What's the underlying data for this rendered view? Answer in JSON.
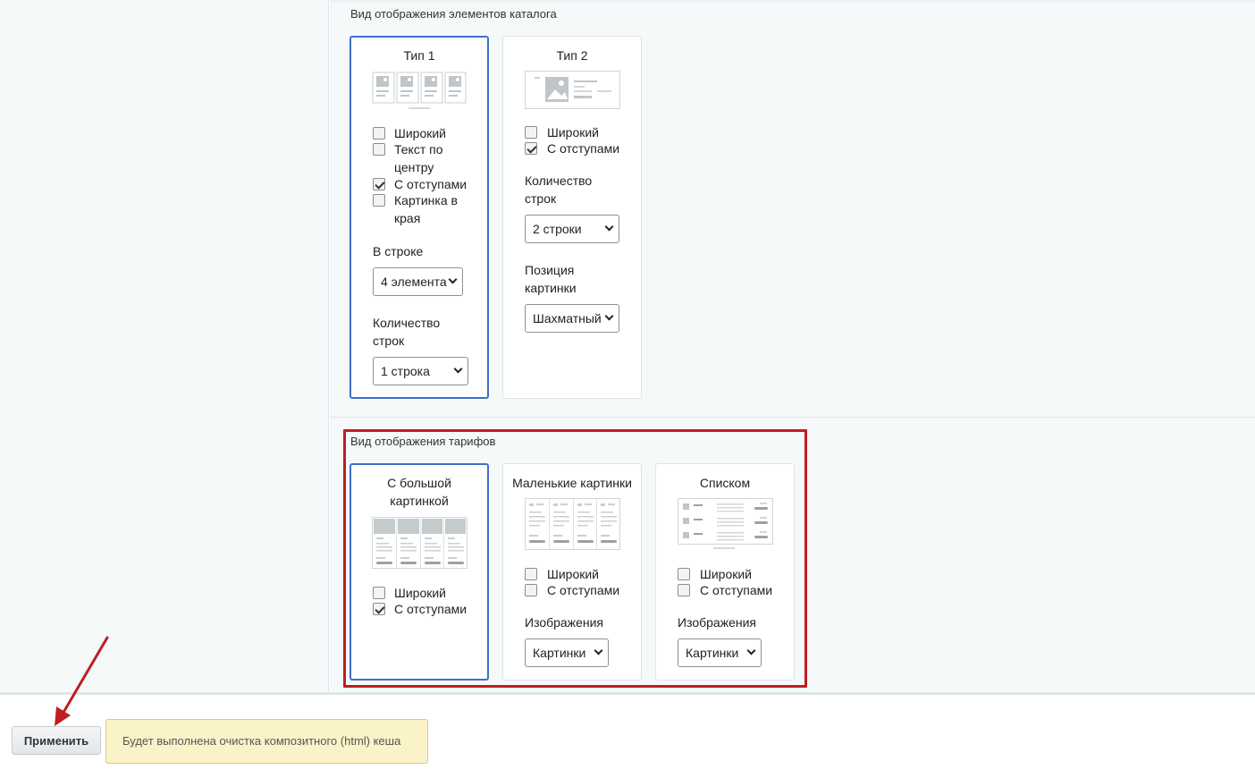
{
  "catalog_section": {
    "title": "Вид отображения элементов каталога",
    "cards": [
      {
        "title": "Тип 1",
        "options": [
          {
            "label_lines": [
              "Широкий"
            ],
            "checked": false
          },
          {
            "label_lines": [
              "Текст по",
              "центру"
            ],
            "checked": false
          },
          {
            "label_lines": [
              "С отступами"
            ],
            "checked": true
          },
          {
            "label_lines": [
              "Картинка в",
              "края"
            ],
            "checked": false
          }
        ],
        "fields": [
          {
            "label_lines": [
              "В строке"
            ],
            "value": "4 элемента"
          },
          {
            "label_lines": [
              "Количество",
              "строк"
            ],
            "value": "1 строка"
          }
        ],
        "selected": true
      },
      {
        "title": "Тип 2",
        "options": [
          {
            "label_lines": [
              "Широкий"
            ],
            "checked": false
          },
          {
            "label_lines": [
              "С отступами"
            ],
            "checked": true
          }
        ],
        "fields": [
          {
            "label_lines": [
              "Количество",
              "строк"
            ],
            "value": "2 строки"
          },
          {
            "label_lines": [
              "Позиция",
              "картинки"
            ],
            "value": "Шахматный"
          }
        ],
        "selected": false
      }
    ]
  },
  "tariffs_section": {
    "title": "Вид отображения тарифов",
    "cards": [
      {
        "title_lines": [
          "С большой",
          "картинкой"
        ],
        "options": [
          {
            "label": "Широкий",
            "checked": false
          },
          {
            "label": "С отступами",
            "checked": true
          }
        ],
        "selected": true
      },
      {
        "title_lines": [
          "Маленькие картинки"
        ],
        "options": [
          {
            "label": "Широкий",
            "checked": false
          },
          {
            "label": "С отступами",
            "checked": false
          }
        ],
        "field": {
          "label": "Изображения",
          "value": "Картинки"
        },
        "selected": false
      },
      {
        "title_lines": [
          "Списком"
        ],
        "options": [
          {
            "label": "Широкий",
            "checked": false
          },
          {
            "label": "С отступами",
            "checked": false
          }
        ],
        "field": {
          "label": "Изображения",
          "value": "Картинки"
        },
        "selected": false
      }
    ]
  },
  "footer": {
    "apply_label": "Применить",
    "notice": "Будет выполнена очистка композитного (html) кеша"
  },
  "colors": {
    "selected_border": "#3d6fc9",
    "highlight": "#c01d22",
    "arrow": "#c01d22",
    "notice_bg": "#fbf3c8"
  }
}
